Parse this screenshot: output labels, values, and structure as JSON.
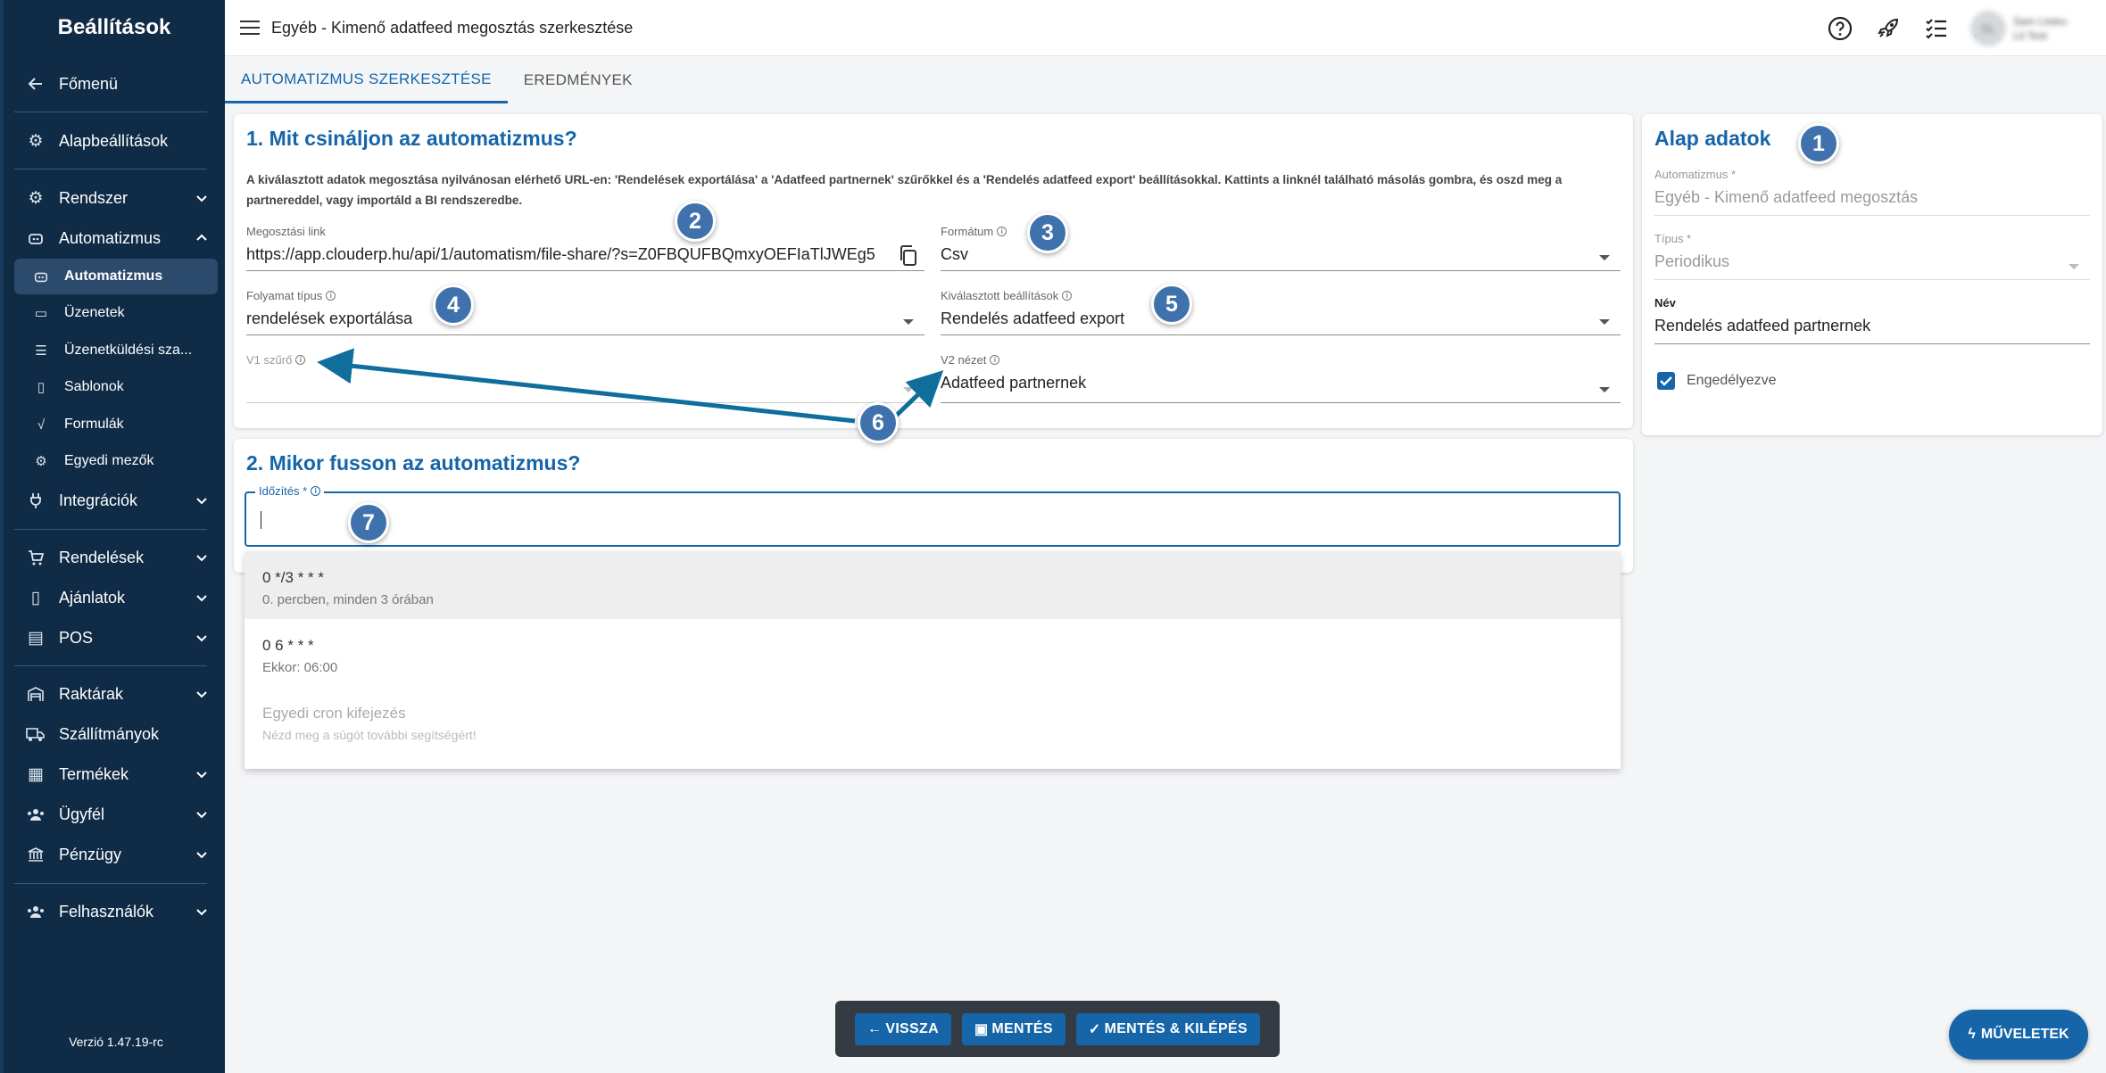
{
  "sidebar": {
    "title": "Beállítások",
    "items": [
      {
        "label": "Főmenü",
        "icon": "arrow-left-icon"
      },
      {
        "label": "Alapbeállítások",
        "icon": "gear-icon"
      },
      {
        "label": "Rendszer",
        "icon": "cogs-icon"
      },
      {
        "label": "Automatizmus",
        "icon": "robot-icon"
      },
      {
        "label": "Automatizmus",
        "icon": "robot-icon"
      },
      {
        "label": "Üzenetek",
        "icon": "inbox-icon"
      },
      {
        "label": "Üzenetküldési sza...",
        "icon": "sliders-icon"
      },
      {
        "label": "Sablonok",
        "icon": "file-icon"
      },
      {
        "label": "Formulák",
        "icon": "sqrt-icon"
      },
      {
        "label": "Egyedi mezők",
        "icon": "cogs-icon"
      },
      {
        "label": "Integrációk",
        "icon": "plug-icon"
      },
      {
        "label": "Rendelések",
        "icon": "cart-icon"
      },
      {
        "label": "Ajánlatok",
        "icon": "document-icon"
      },
      {
        "label": "POS",
        "icon": "cash-register-icon"
      },
      {
        "label": "Raktárak",
        "icon": "warehouse-icon"
      },
      {
        "label": "Szállítmányok",
        "icon": "truck-icon"
      },
      {
        "label": "Termékek",
        "icon": "box-icon"
      },
      {
        "label": "Ügyfél",
        "icon": "users-icon"
      },
      {
        "label": "Pénzügy",
        "icon": "bank-icon"
      },
      {
        "label": "Felhasználók",
        "icon": "user-group-icon"
      }
    ],
    "version": "Verzió 1.47.19-rc"
  },
  "topbar": {
    "title": "Egyéb - Kimenő adatfeed megosztás szerkesztése",
    "user_initials": "SL",
    "user_name": "Sam Listeu",
    "user_sub": "Lit Test"
  },
  "tabs": [
    "AUTOMATIZMUS SZERKESZTÉSE",
    "EREDMÉNYEK"
  ],
  "section1": {
    "title": "1. Mit csináljon az automatizmus?",
    "description": "A kiválasztott adatok megosztása nyilvánosan elérhető URL-en: 'Rendelések exportálása' a 'Adatfeed partnernek' szűrőkkel és a 'Rendelés adatfeed export' beállításokkal. Kattints a linknél található másolás gombra, és oszd meg a partnereddel, vagy importáld a BI rendszeredbe.",
    "share_link_label": "Megosztási link",
    "share_link_value": "https://app.clouderp.hu/api/1/automatism/file-share/?s=Z0FBQUFBQmxyOEFIaTlJWEg5",
    "format_label": "Formátum",
    "format_value": "Csv",
    "process_type_label": "Folyamat típus",
    "process_type_value": "rendelések exportálása",
    "selected_settings_label": "Kiválasztott beállítások",
    "selected_settings_value": "Rendelés adatfeed export",
    "v1_filter_label": "V1 szűrő",
    "v2_view_label": "V2 nézet",
    "v2_view_value": "Adatfeed partnernek"
  },
  "section2": {
    "title": "2. Mikor fusson az automatizmus?",
    "schedule_label": "Időzítés *",
    "options": [
      {
        "main": "0 */3 * * *",
        "sub": "0. percben, minden 3 órában"
      },
      {
        "main": "0 6 * * *",
        "sub": "Ekkor: 06:00"
      },
      {
        "main": "Egyedi cron kifejezés",
        "sub": "Nézd meg a súgót további segítségért!"
      }
    ]
  },
  "basic": {
    "title": "Alap adatok",
    "automatism_label": "Automatizmus *",
    "automatism_value": "Egyéb - Kimenő adatfeed megosztás",
    "type_label": "Típus *",
    "type_value": "Periodikus",
    "name_label": "Név",
    "name_value": "Rendelés adatfeed partnernek",
    "enabled_label": "Engedélyezve"
  },
  "badges": [
    "1",
    "2",
    "3",
    "4",
    "5",
    "6",
    "7"
  ],
  "buttons": {
    "back": "VISSZA",
    "save": "MENTÉS",
    "save_exit": "MENTÉS & KILÉPÉS",
    "actions": "MŰVELETEK"
  },
  "colors": {
    "sidebar": "#0f2b46",
    "accent": "#1565a8",
    "badge": "#3f72ad",
    "arrow": "#0f6e9c"
  }
}
